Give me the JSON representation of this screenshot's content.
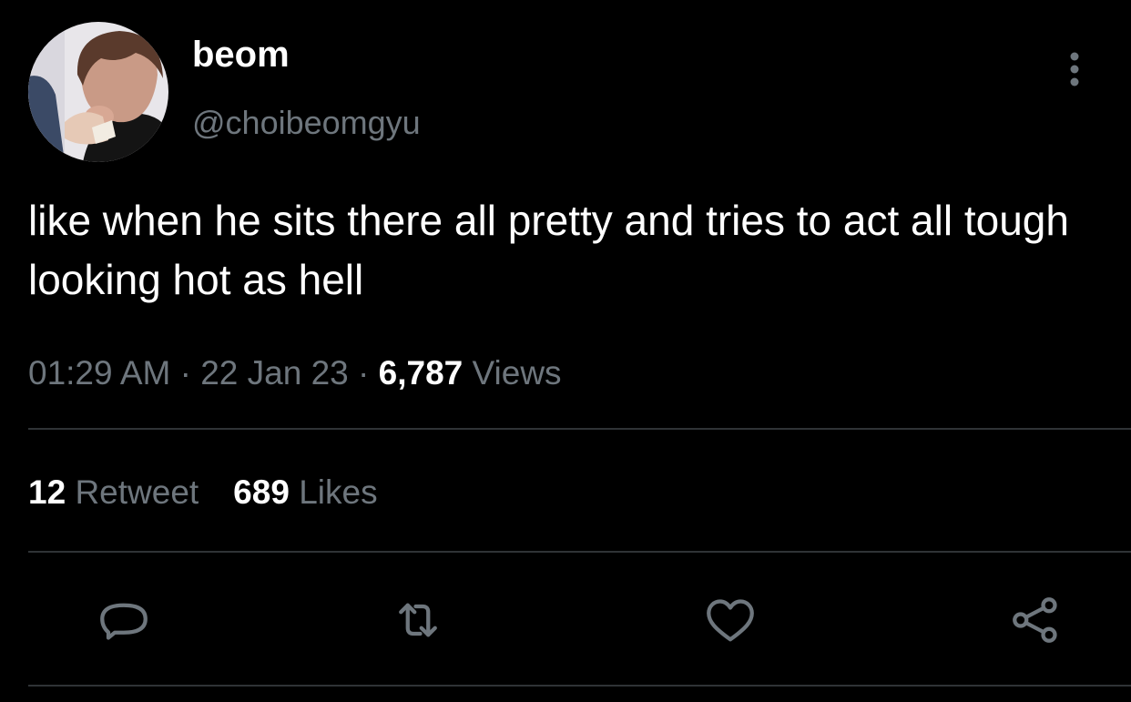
{
  "tweet": {
    "author": {
      "display_name": "beom",
      "handle": "@choibeomgyu"
    },
    "text": "like when he sits there all pretty and tries to act all tough looking hot as hell",
    "time": "01:29 AM",
    "date": "22 Jan 23",
    "views_count": "6,787",
    "views_label": "Views",
    "separator": " · "
  },
  "stats": {
    "retweets_count": "12",
    "retweets_label": "Retweet",
    "likes_count": "689",
    "likes_label": "Likes"
  },
  "actions": [
    {
      "icon": "reply-icon"
    },
    {
      "icon": "retweet-icon"
    },
    {
      "icon": "like-icon"
    },
    {
      "icon": "share-icon"
    }
  ],
  "colors": {
    "background": "#000000",
    "primary_text": "#ffffff",
    "secondary_text": "#6e767d",
    "divider": "#2f3336"
  }
}
